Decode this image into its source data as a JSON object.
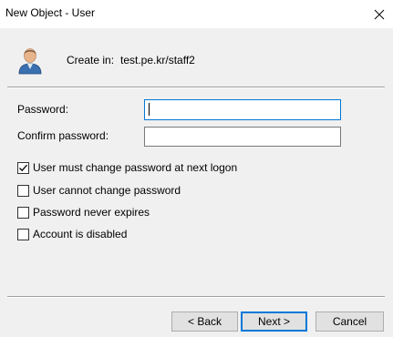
{
  "window": {
    "title": "New Object - User",
    "close_icon": "close-icon"
  },
  "header": {
    "icon": "user-icon",
    "create_in_label": "Create in:",
    "create_in_value": "test.pe.kr/staff2"
  },
  "form": {
    "password_label": "Password:",
    "password_value": "",
    "confirm_label": "Confirm password:",
    "confirm_value": ""
  },
  "options": [
    {
      "label": "User must change password at next logon",
      "checked": true
    },
    {
      "label": "User cannot change password",
      "checked": false
    },
    {
      "label": "Password never expires",
      "checked": false
    },
    {
      "label": "Account is disabled",
      "checked": false
    }
  ],
  "buttons": {
    "back": "< Back",
    "next": "Next >",
    "cancel": "Cancel"
  },
  "colors": {
    "accent": "#0078d7",
    "window_bg": "#f0f0f0",
    "titlebar_bg": "#ffffff"
  }
}
